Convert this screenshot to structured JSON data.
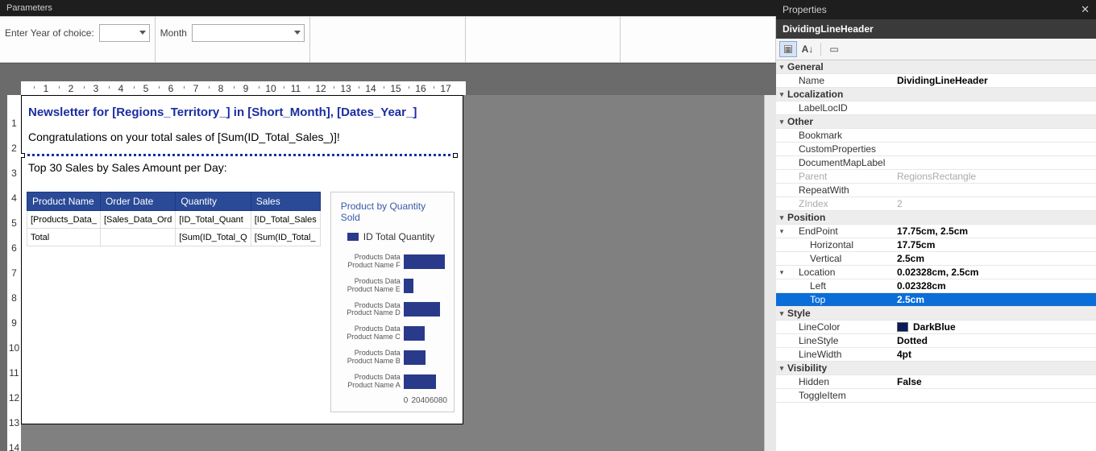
{
  "parameters": {
    "header": "Parameters",
    "fields": [
      {
        "label": "Enter Year of choice:",
        "value": ""
      },
      {
        "label": "Month",
        "value": ""
      }
    ]
  },
  "ruler": {
    "hticks": [
      1,
      2,
      3,
      4,
      5,
      6,
      7,
      8,
      9,
      10,
      11,
      12,
      13,
      14,
      15,
      16,
      17
    ],
    "vticks": [
      1,
      2,
      3,
      4,
      5,
      6,
      7,
      8,
      9,
      10,
      11,
      12,
      13,
      14
    ]
  },
  "report": {
    "title": "Newsletter for [Regions_Territory_] in [Short_Month], [Dates_Year_]",
    "congrats": "Congratulations on your total sales of [Sum(ID_Total_Sales_)]!",
    "subhead": "Top 30 Sales by Sales Amount per Day:",
    "table": {
      "headers": [
        "Product Name",
        "Order Date",
        "Quantity",
        "Sales"
      ],
      "rows": [
        [
          "[Products_Data_",
          "[Sales_Data_Ord",
          "[ID_Total_Quant",
          "[ID_Total_Sales"
        ],
        [
          "Total",
          "",
          "[Sum(ID_Total_Q",
          "[Sum(ID_Total_"
        ]
      ]
    }
  },
  "chart_data": {
    "type": "bar",
    "orientation": "horizontal",
    "title": "Product by Quantity Sold",
    "legend": {
      "label": "ID Total Quantity"
    },
    "categories": [
      "Products Data Product Name F",
      "Products Data Product Name E",
      "Products Data Product Name D",
      "Products Data Product Name C",
      "Products Data Product Name B",
      "Products Data Product Name A"
    ],
    "values": [
      85,
      20,
      75,
      44,
      46,
      66
    ],
    "xlabel": "",
    "ylabel": "",
    "xlim": [
      0,
      90
    ],
    "xticks": [
      0,
      20,
      40,
      60,
      80
    ]
  },
  "properties": {
    "header": "Properties",
    "object_name": "DividingLineHeader",
    "groups": [
      {
        "category": "General",
        "rows": [
          {
            "key": "Name",
            "val": "DividingLineHeader",
            "bold": true
          }
        ]
      },
      {
        "category": "Localization",
        "rows": [
          {
            "key": "LabelLocID",
            "val": ""
          }
        ]
      },
      {
        "category": "Other",
        "rows": [
          {
            "key": "Bookmark",
            "val": ""
          },
          {
            "key": "CustomProperties",
            "val": ""
          },
          {
            "key": "DocumentMapLabel",
            "val": ""
          },
          {
            "key": "Parent",
            "val": "RegionsRectangle",
            "disabled": true
          },
          {
            "key": "RepeatWith",
            "val": ""
          },
          {
            "key": "ZIndex",
            "val": "2",
            "disabled": true
          }
        ]
      },
      {
        "category": "Position",
        "rows": [
          {
            "key": "EndPoint",
            "val": "17.75cm, 2.5cm",
            "expandable": true,
            "bold": true
          },
          {
            "key": "Horizontal",
            "val": "17.75cm",
            "sub": true,
            "bold": true
          },
          {
            "key": "Vertical",
            "val": "2.5cm",
            "sub": true,
            "bold": true
          },
          {
            "key": "Location",
            "val": "0.02328cm, 2.5cm",
            "expandable": true,
            "bold": true
          },
          {
            "key": "Left",
            "val": "0.02328cm",
            "sub": true,
            "bold": true
          },
          {
            "key": "Top",
            "val": "2.5cm",
            "sub": true,
            "selected": true,
            "bold": true
          }
        ]
      },
      {
        "category": "Style",
        "rows": [
          {
            "key": "LineColor",
            "val": "DarkBlue",
            "swatch": "#0a1a5a",
            "bold": true
          },
          {
            "key": "LineStyle",
            "val": "Dotted",
            "bold": true
          },
          {
            "key": "LineWidth",
            "val": "4pt",
            "bold": true
          }
        ]
      },
      {
        "category": "Visibility",
        "rows": [
          {
            "key": "Hidden",
            "val": "False",
            "bold": true
          },
          {
            "key": "ToggleItem",
            "val": ""
          }
        ]
      }
    ]
  }
}
